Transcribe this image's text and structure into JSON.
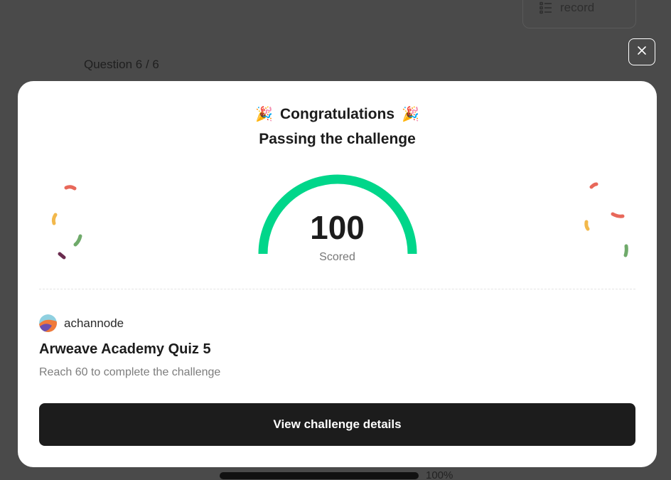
{
  "background": {
    "answer_record_label": "Answer record",
    "question_counter": "Question 6 / 6",
    "progress_label": "100%",
    "progress_value": 1.0
  },
  "modal": {
    "party_icon": "party-popper-icon",
    "title": "Congratulations",
    "subtitle": "Passing the challenge",
    "score": "100",
    "score_label": "Scored",
    "gauge_fraction": 1.0,
    "gauge_color": "#00d68a",
    "author_name": "achannode",
    "quiz_title": "Arweave Academy Quiz 5",
    "requirement": "Reach 60 to complete the challenge",
    "cta_label": "View challenge details"
  },
  "colors": {
    "overlay": "#4a4a4a",
    "cta_bg": "#1c1c1c",
    "confetti": [
      "#e8685a",
      "#f2b84b",
      "#6faa6a",
      "#6a2c4f"
    ]
  }
}
